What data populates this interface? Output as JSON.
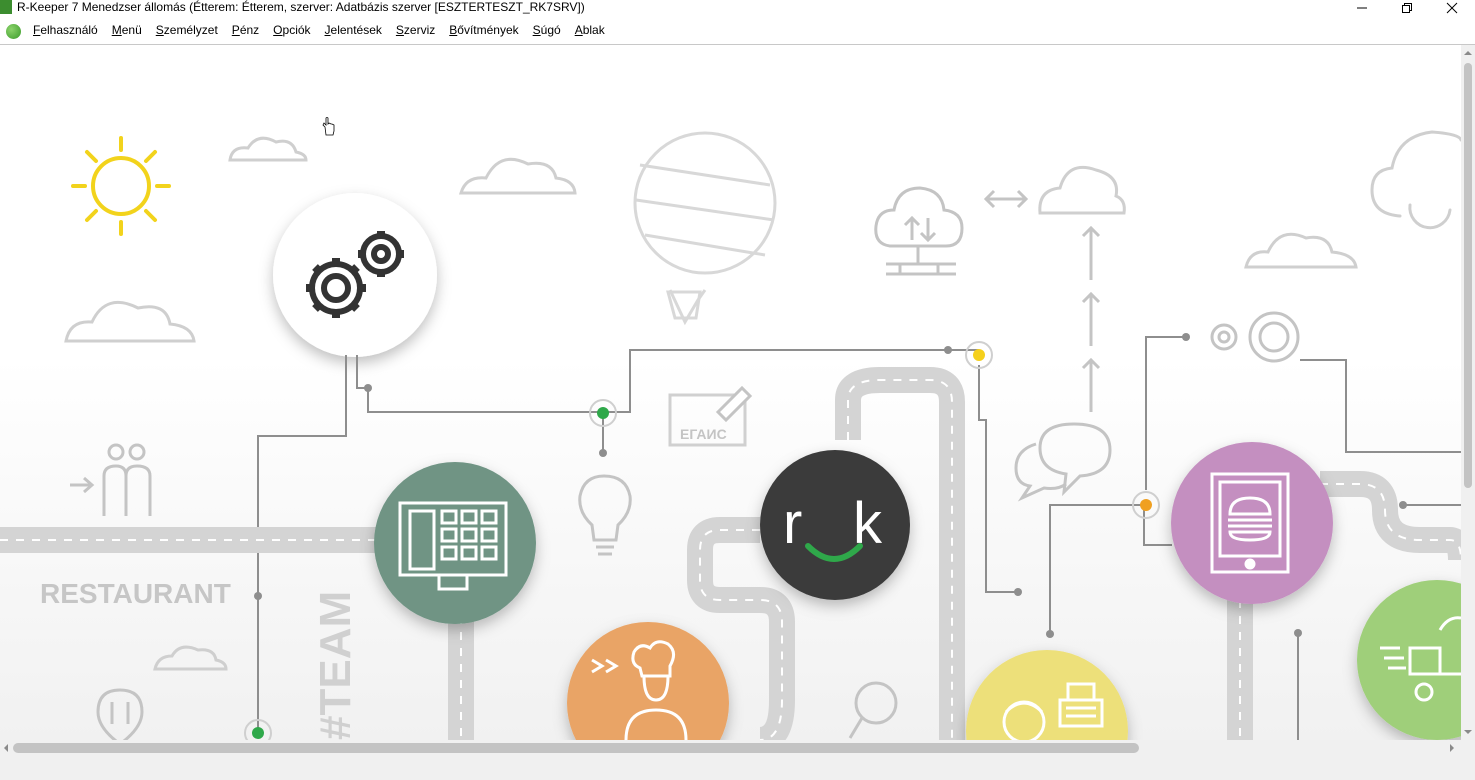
{
  "window": {
    "title": "R-Keeper 7 Menedzser állomás (Étterem: Étterem, szerver: Adatbázis szerver [ESZTERTESZT_RK7SRV])",
    "minimize_icon": "minimize-icon",
    "restore_icon": "restore-icon",
    "close_icon": "close-icon"
  },
  "menu": {
    "items": [
      {
        "key": "F",
        "rest": "elhasználó"
      },
      {
        "key": "M",
        "rest": "enü"
      },
      {
        "key": "S",
        "rest": "zemélyzet"
      },
      {
        "key": "P",
        "rest": "énz"
      },
      {
        "key": "O",
        "rest": "pciók"
      },
      {
        "key": "J",
        "rest": "elentések"
      },
      {
        "key": "S",
        "rest": "zerviz"
      },
      {
        "key": "B",
        "rest": "ővítmények"
      },
      {
        "key": "S",
        "rest": "úgó"
      },
      {
        "key": "A",
        "rest": "blak"
      }
    ]
  },
  "background": {
    "restaurant_label": "RESTAURANT",
    "team_label": "#TEAM",
    "egais_label": "ЕГАИС",
    "logo_r": "r",
    "logo_k": "k",
    "colors": {
      "sun": "#f2d31c",
      "terminal_circle": "#6f9484",
      "logo_circle": "#3b3b3b",
      "logo_smile": "#2fa84a",
      "tablet_circle": "#c48fc0",
      "chef_circle": "#e9a466",
      "cashier_circle": "#ede07a",
      "delivery_circle": "#9fcf7a",
      "node_green": "#2fa84a",
      "node_yellow": "#f5d01c",
      "node_orange": "#f0a020"
    }
  }
}
